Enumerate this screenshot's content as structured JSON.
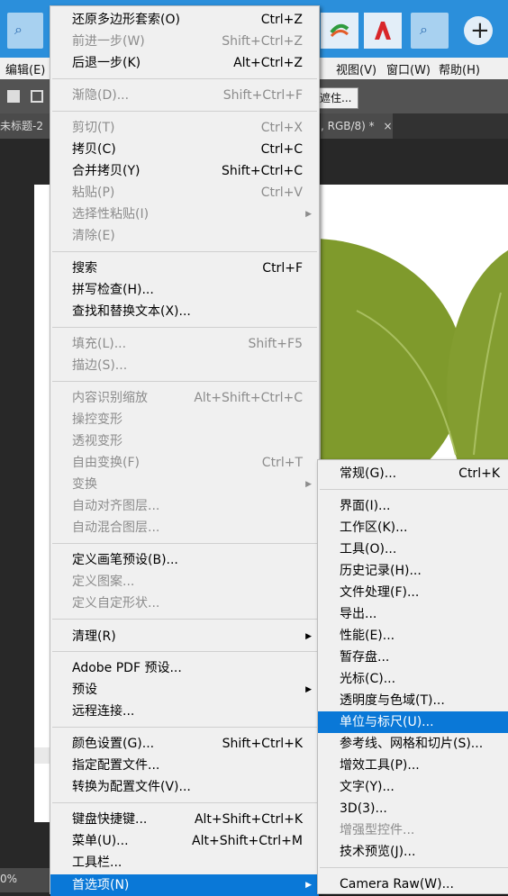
{
  "taskbar": {
    "search_icon": "search-icon",
    "apps": [
      "green-app-icon",
      "red-app-icon",
      "adobe-icon"
    ],
    "search2_icon": "search-icon",
    "add_icon": "plus-icon"
  },
  "menubar": {
    "items": [
      "编辑(E)",
      "视图(V)",
      "窗口(W)",
      "帮助(H)"
    ]
  },
  "options_bar": {
    "fragment": "遮住..."
  },
  "tabs": {
    "left": "未标题-2 @",
    "right": ", RGB/8) *",
    "close": "×"
  },
  "status": {
    "zoom": "0%"
  },
  "edit_menu": {
    "items": [
      {
        "label": "还原多边形套索(O)",
        "shortcut": "Ctrl+Z",
        "disabled": false
      },
      {
        "label": "前进一步(W)",
        "shortcut": "Shift+Ctrl+Z",
        "disabled": true
      },
      {
        "label": "后退一步(K)",
        "shortcut": "Alt+Ctrl+Z",
        "disabled": false
      },
      {
        "label": "渐隐(D)...",
        "shortcut": "Shift+Ctrl+F",
        "disabled": true
      },
      {
        "label": "剪切(T)",
        "shortcut": "Ctrl+X",
        "disabled": true
      },
      {
        "label": "拷贝(C)",
        "shortcut": "Ctrl+C",
        "disabled": false
      },
      {
        "label": "合并拷贝(Y)",
        "shortcut": "Shift+Ctrl+C",
        "disabled": false
      },
      {
        "label": "粘贴(P)",
        "shortcut": "Ctrl+V",
        "disabled": true
      },
      {
        "label": "选择性粘贴(I)",
        "shortcut": "",
        "disabled": true,
        "submenu": true
      },
      {
        "label": "清除(E)",
        "shortcut": "",
        "disabled": true
      },
      {
        "label": "搜索",
        "shortcut": "Ctrl+F",
        "disabled": false
      },
      {
        "label": "拼写检查(H)...",
        "shortcut": "",
        "disabled": false
      },
      {
        "label": "查找和替换文本(X)...",
        "shortcut": "",
        "disabled": false
      },
      {
        "label": "填充(L)...",
        "shortcut": "Shift+F5",
        "disabled": true
      },
      {
        "label": "描边(S)...",
        "shortcut": "",
        "disabled": true
      },
      {
        "label": "内容识别缩放",
        "shortcut": "Alt+Shift+Ctrl+C",
        "disabled": true
      },
      {
        "label": "操控变形",
        "shortcut": "",
        "disabled": true
      },
      {
        "label": "透视变形",
        "shortcut": "",
        "disabled": true
      },
      {
        "label": "自由变换(F)",
        "shortcut": "Ctrl+T",
        "disabled": true
      },
      {
        "label": "变换",
        "shortcut": "",
        "disabled": true,
        "submenu": true
      },
      {
        "label": "自动对齐图层...",
        "shortcut": "",
        "disabled": true
      },
      {
        "label": "自动混合图层...",
        "shortcut": "",
        "disabled": true
      },
      {
        "label": "定义画笔预设(B)...",
        "shortcut": "",
        "disabled": false
      },
      {
        "label": "定义图案...",
        "shortcut": "",
        "disabled": true
      },
      {
        "label": "定义自定形状...",
        "shortcut": "",
        "disabled": true
      },
      {
        "label": "清理(R)",
        "shortcut": "",
        "disabled": false,
        "submenu": true
      },
      {
        "label": "Adobe PDF 预设...",
        "shortcut": "",
        "disabled": false
      },
      {
        "label": "预设",
        "shortcut": "",
        "disabled": false,
        "submenu": true
      },
      {
        "label": "远程连接...",
        "shortcut": "",
        "disabled": false
      },
      {
        "label": "颜色设置(G)...",
        "shortcut": "Shift+Ctrl+K",
        "disabled": false
      },
      {
        "label": "指定配置文件...",
        "shortcut": "",
        "disabled": false
      },
      {
        "label": "转换为配置文件(V)...",
        "shortcut": "",
        "disabled": false
      },
      {
        "label": "键盘快捷键...",
        "shortcut": "Alt+Shift+Ctrl+K",
        "disabled": false
      },
      {
        "label": "菜单(U)...",
        "shortcut": "Alt+Shift+Ctrl+M",
        "disabled": false
      },
      {
        "label": "工具栏...",
        "shortcut": "",
        "disabled": false
      },
      {
        "label": "首选项(N)",
        "shortcut": "",
        "disabled": false,
        "submenu": true,
        "highlighted": true
      }
    ]
  },
  "prefs_submenu": {
    "items": [
      {
        "label": "常规(G)...",
        "shortcut": "Ctrl+K"
      },
      {
        "label": "界面(I)..."
      },
      {
        "label": "工作区(K)..."
      },
      {
        "label": "工具(O)..."
      },
      {
        "label": "历史记录(H)..."
      },
      {
        "label": "文件处理(F)..."
      },
      {
        "label": "导出..."
      },
      {
        "label": "性能(E)..."
      },
      {
        "label": "暂存盘..."
      },
      {
        "label": "光标(C)..."
      },
      {
        "label": "透明度与色域(T)..."
      },
      {
        "label": "单位与标尺(U)...",
        "highlighted": true
      },
      {
        "label": "参考线、网格和切片(S)..."
      },
      {
        "label": "增效工具(P)..."
      },
      {
        "label": "文字(Y)..."
      },
      {
        "label": "3D(3)..."
      },
      {
        "label": "增强型控件...",
        "disabled": true
      },
      {
        "label": "技术预览(J)..."
      },
      {
        "label": "Camera Raw(W)..."
      }
    ]
  },
  "colors": {
    "highlight": "#0a78d7",
    "leaf": "#7f9a2c",
    "taskbar": "#2b8fdb"
  }
}
